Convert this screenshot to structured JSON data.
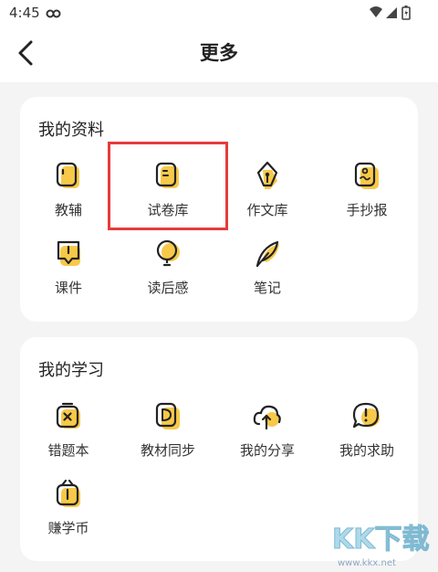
{
  "status_bar": {
    "time": "4:45"
  },
  "header": {
    "title": "更多"
  },
  "sections": [
    {
      "title": "我的资料",
      "items": [
        {
          "label": "教辅",
          "icon": "guide-book-icon"
        },
        {
          "label": "试卷库",
          "icon": "exam-paper-icon"
        },
        {
          "label": "作文库",
          "icon": "pen-nib-icon"
        },
        {
          "label": "手抄报",
          "icon": "handwritten-paper-icon"
        },
        {
          "label": "课件",
          "icon": "courseware-icon"
        },
        {
          "label": "读后感",
          "icon": "lightbulb-icon"
        },
        {
          "label": "笔记",
          "icon": "feather-icon"
        }
      ]
    },
    {
      "title": "我的学习",
      "items": [
        {
          "label": "错题本",
          "icon": "wrong-answer-book-icon"
        },
        {
          "label": "教材同步",
          "icon": "textbook-sync-icon"
        },
        {
          "label": "我的分享",
          "icon": "cloud-upload-icon"
        },
        {
          "label": "我的求助",
          "icon": "help-exclamation-icon"
        },
        {
          "label": "赚学币",
          "icon": "gift-coin-icon"
        }
      ]
    }
  ],
  "watermark": {
    "logo_text": "KK下载",
    "url": "www.kkx.net"
  },
  "colors": {
    "accent_yellow": "#f7c948",
    "highlight_red": "#e63b3b",
    "icon_stroke": "#222222"
  }
}
